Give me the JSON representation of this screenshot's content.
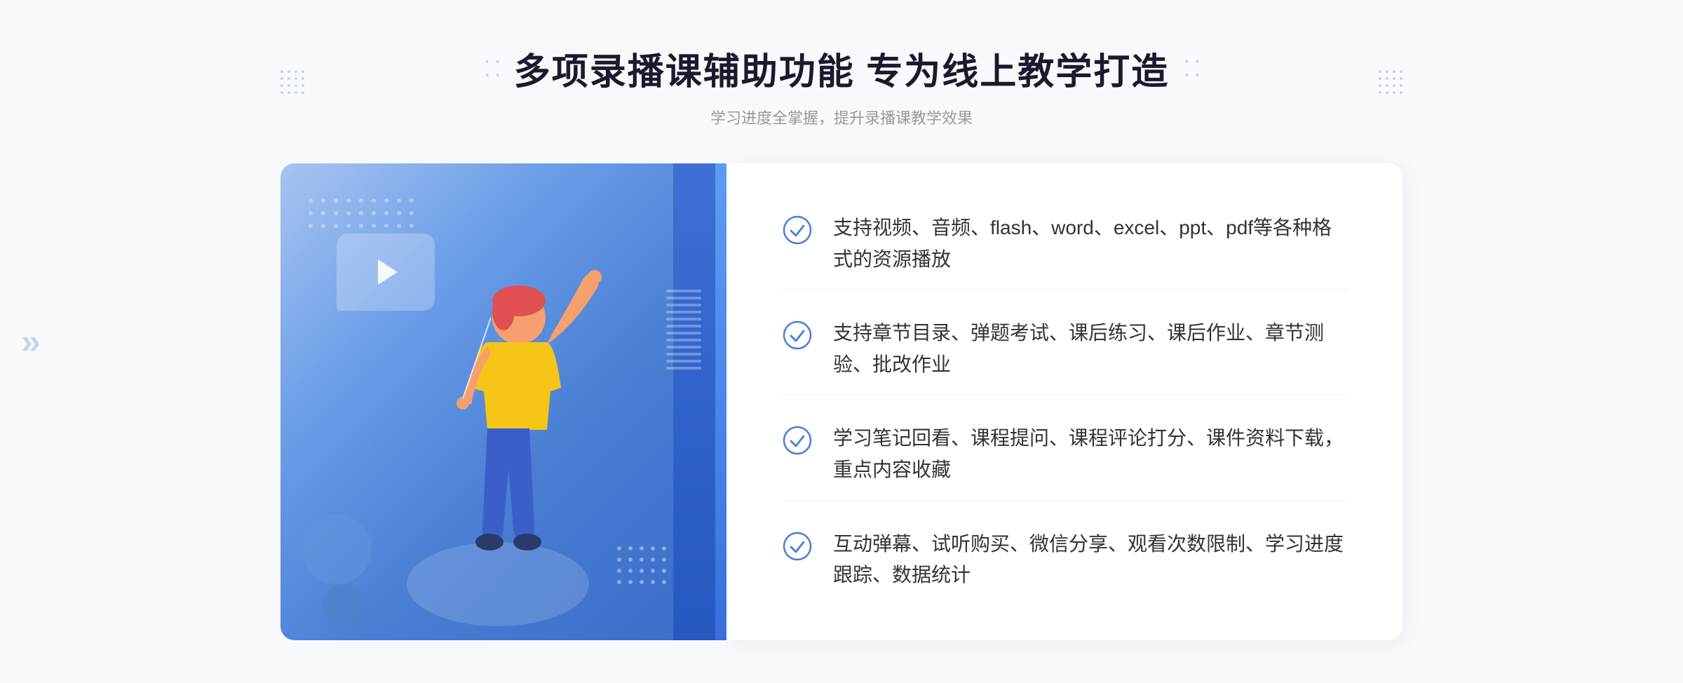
{
  "page": {
    "background": "#f8f9fc"
  },
  "header": {
    "deco_left": "⁞⁞",
    "deco_right": "⁞⁞",
    "main_title": "多项录播课辅助功能 专为线上教学打造",
    "sub_title": "学习进度全掌握，提升录播课教学效果"
  },
  "features": [
    {
      "id": 1,
      "text": "支持视频、音频、flash、word、excel、ppt、pdf等各种格式的资源播放"
    },
    {
      "id": 2,
      "text": "支持章节目录、弹题考试、课后练习、课后作业、章节测验、批改作业"
    },
    {
      "id": 3,
      "text": "学习笔记回看、课程提问、课程评论打分、课件资料下载，重点内容收藏"
    },
    {
      "id": 4,
      "text": "互动弹幕、试听购买、微信分享、观看次数限制、学习进度跟踪、数据统计"
    }
  ],
  "icons": {
    "check": "check-circle-icon",
    "play": "play-icon",
    "left_chevron": "chevron-left-icon"
  },
  "colors": {
    "primary": "#4a7fd4",
    "accent": "#3a6bc8",
    "text_dark": "#1a1a2e",
    "text_muted": "#999999",
    "feature_text": "#333333",
    "check_color": "#4a7fd4",
    "bg": "#f8f9fc"
  }
}
